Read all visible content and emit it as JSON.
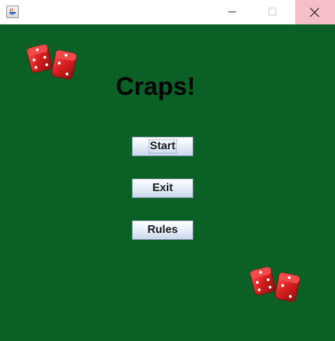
{
  "window": {
    "icon": "java-cup-icon",
    "controls": [
      "minimize-icon",
      "maximize-icon",
      "close-icon"
    ]
  },
  "colors": {
    "background": "#0b6125",
    "title_text": "#050505",
    "close_hover": "#f5bfc7",
    "dice": "#d81f1f"
  },
  "main": {
    "title": "Craps!",
    "buttons": {
      "start": "Start",
      "exit": "Exit",
      "rules": "Rules"
    },
    "images": [
      "dice-pair",
      "dice-pair"
    ]
  }
}
